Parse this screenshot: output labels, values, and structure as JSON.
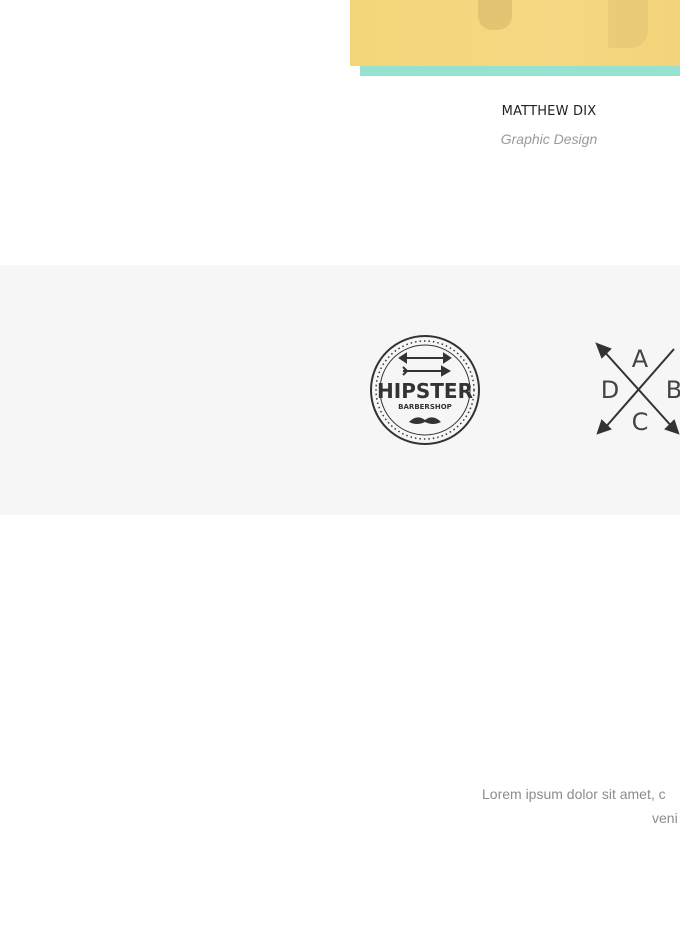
{
  "team": {
    "member": {
      "name": "MATTHEW DIX",
      "role": "Graphic Design"
    },
    "colors": {
      "photo": "#f4d679",
      "accent_bar": "#94e2cf"
    }
  },
  "clients": {
    "background": "#f6f6f6",
    "logos": [
      {
        "icon": "hipster-barbershop-logo",
        "title": "HIPSTER",
        "subtitle": "BARBERSHOP"
      },
      {
        "icon": "crossed-arrows-logo",
        "letters": [
          "A",
          "B",
          "C",
          "D"
        ]
      }
    ]
  },
  "intro": {
    "line1": "Lorem ipsum dolor sit amet, c",
    "line2": "veni"
  }
}
